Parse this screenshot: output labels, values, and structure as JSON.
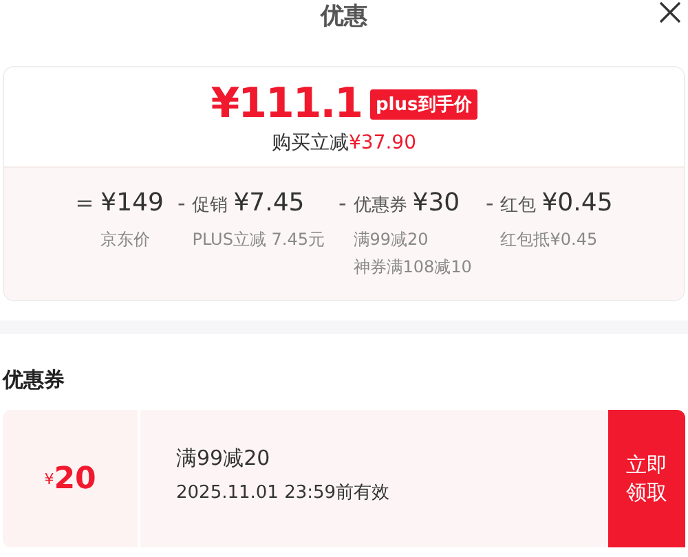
{
  "header": {
    "title": "优惠"
  },
  "summary": {
    "price": "¥111.1",
    "badge": "plus到手价",
    "saving_label": "购买立减",
    "saving_amount": "¥37.90",
    "breakdown": [
      {
        "sign": "=",
        "amount": "¥149",
        "notes": [
          "京东价"
        ]
      },
      {
        "sign": "-",
        "label": "促销",
        "amount": "¥7.45",
        "notes": [
          "PLUS立减 7.45元"
        ]
      },
      {
        "sign": "-",
        "label": "优惠券",
        "amount": "¥30",
        "notes": [
          "满99减20",
          "神券满108减10"
        ]
      },
      {
        "sign": "-",
        "label": "红包",
        "amount": "¥0.45",
        "notes": [
          "红包抵¥0.45"
        ]
      }
    ]
  },
  "coupons": {
    "heading": "优惠券",
    "items": [
      {
        "currency": "¥",
        "value": "20",
        "condition": "满99减20",
        "validity": "2025.11.01 23:59前有效",
        "action": "立即领取"
      }
    ]
  }
}
